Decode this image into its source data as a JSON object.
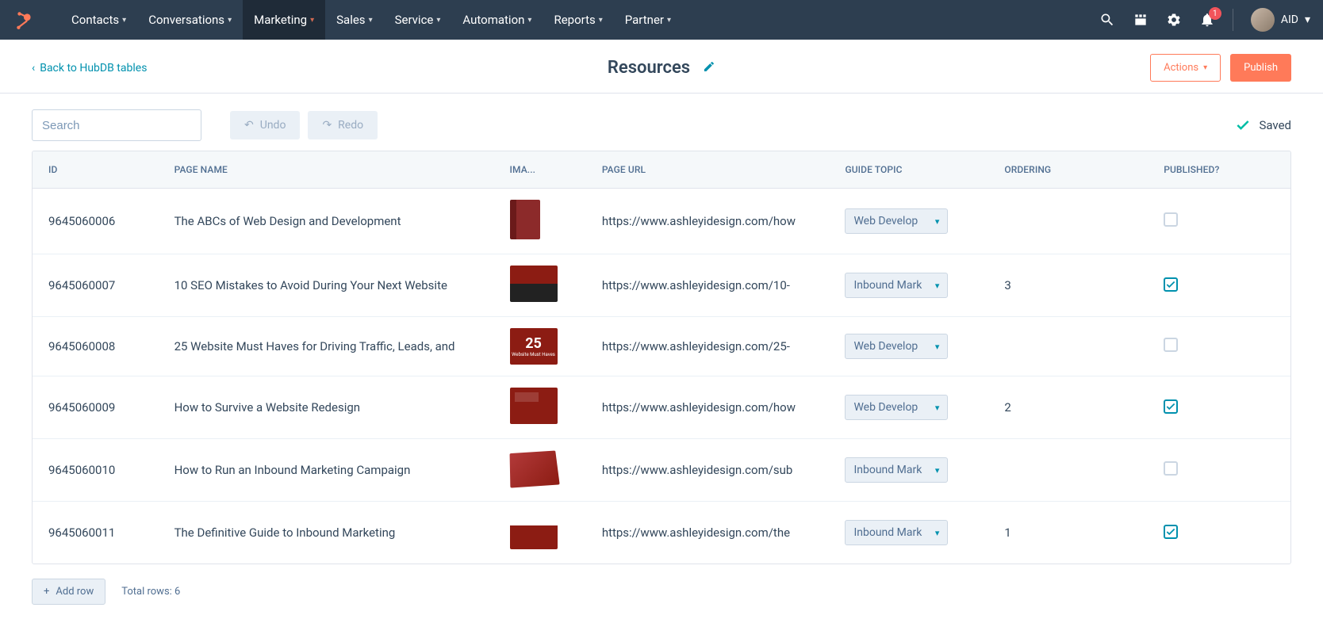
{
  "nav": {
    "items": [
      {
        "label": "Contacts",
        "active": false
      },
      {
        "label": "Conversations",
        "active": false
      },
      {
        "label": "Marketing",
        "active": true
      },
      {
        "label": "Sales",
        "active": false
      },
      {
        "label": "Service",
        "active": false
      },
      {
        "label": "Automation",
        "active": false
      },
      {
        "label": "Reports",
        "active": false
      },
      {
        "label": "Partner",
        "active": false
      }
    ],
    "notification_count": "1",
    "account_label": "AID"
  },
  "header": {
    "back_label": "Back to HubDB tables",
    "title": "Resources",
    "actions_label": "Actions",
    "publish_label": "Publish"
  },
  "toolbar": {
    "search_placeholder": "Search",
    "undo_label": "Undo",
    "redo_label": "Redo",
    "saved_label": "Saved"
  },
  "table": {
    "columns": {
      "id": "ID",
      "page_name": "PAGE NAME",
      "image": "IMA...",
      "page_url": "PAGE URL",
      "guide_topic": "GUIDE TOPIC",
      "ordering": "ORDERING",
      "published": "PUBLISHED?"
    },
    "rows": [
      {
        "id": "9645060006",
        "name": "The ABCs of Web Design and Development",
        "url": "https://www.ashleyidesign.com/how",
        "topic": "Web Develop",
        "ordering": "",
        "published": false,
        "thumb": "book"
      },
      {
        "id": "9645060007",
        "name": "10 SEO Mistakes to Avoid During Your Next Website",
        "url": "https://www.ashleyidesign.com/10-",
        "topic": "Inbound Mark",
        "ordering": "3",
        "published": true,
        "thumb": "seo"
      },
      {
        "id": "9645060008",
        "name": "25 Website Must Haves for Driving Traffic, Leads, and",
        "url": "https://www.ashleyidesign.com/25-",
        "topic": "Web Develop",
        "ordering": "",
        "published": false,
        "thumb": "n25"
      },
      {
        "id": "9645060009",
        "name": "How to Survive a Website Redesign",
        "url": "https://www.ashleyidesign.com/how",
        "topic": "Web Develop",
        "ordering": "2",
        "published": true,
        "thumb": "redesign"
      },
      {
        "id": "9645060010",
        "name": "How to Run an Inbound Marketing Campaign",
        "url": "https://www.ashleyidesign.com/sub",
        "topic": "Inbound Mark",
        "ordering": "",
        "published": false,
        "thumb": "campaign"
      },
      {
        "id": "9645060011",
        "name": "The Definitive Guide to Inbound Marketing",
        "url": "https://www.ashleyidesign.com/the",
        "topic": "Inbound Mark",
        "ordering": "1",
        "published": true,
        "thumb": "guide"
      }
    ]
  },
  "footer": {
    "add_row_label": "Add row",
    "total_label": "Total rows: 6"
  }
}
